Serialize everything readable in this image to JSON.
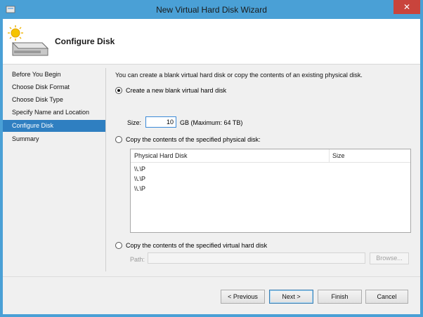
{
  "window": {
    "title": "New Virtual Hard Disk Wizard",
    "close_glyph": "✕"
  },
  "header": {
    "title": "Configure Disk",
    "icon": "virtual-disk-icon"
  },
  "nav": {
    "items": [
      {
        "label": "Before You Begin",
        "active": false
      },
      {
        "label": "Choose Disk Format",
        "active": false
      },
      {
        "label": "Choose Disk Type",
        "active": false
      },
      {
        "label": "Specify Name and Location",
        "active": false
      },
      {
        "label": "Configure Disk",
        "active": true
      },
      {
        "label": "Summary",
        "active": false
      }
    ]
  },
  "content": {
    "intro": "You can create a blank virtual hard disk or copy the contents of an existing physical disk.",
    "option_new": "Create a new blank virtual hard disk",
    "size_label": "Size:",
    "size_value": "10",
    "size_unit": "GB (Maximum: 64 TB)",
    "option_physical": "Copy the contents of the specified physical disk:",
    "physical_table": {
      "columns": [
        "Physical Hard Disk",
        "Size"
      ],
      "rows": [
        {
          "disk": "\\\\.\\P"
        },
        {
          "disk": "\\\\.\\P"
        },
        {
          "disk": "\\\\.\\P"
        }
      ]
    },
    "option_virtual": "Copy the contents of the specified virtual hard disk",
    "path_label": "Path:",
    "path_value": "",
    "browse_label": "Browse..."
  },
  "buttons": {
    "previous": "< Previous",
    "next": "Next >",
    "finish": "Finish",
    "cancel": "Cancel"
  },
  "colors": {
    "titlebar": "#4aa0d6",
    "nav_active": "#2f7fc1",
    "close_button": "#c9443c"
  }
}
